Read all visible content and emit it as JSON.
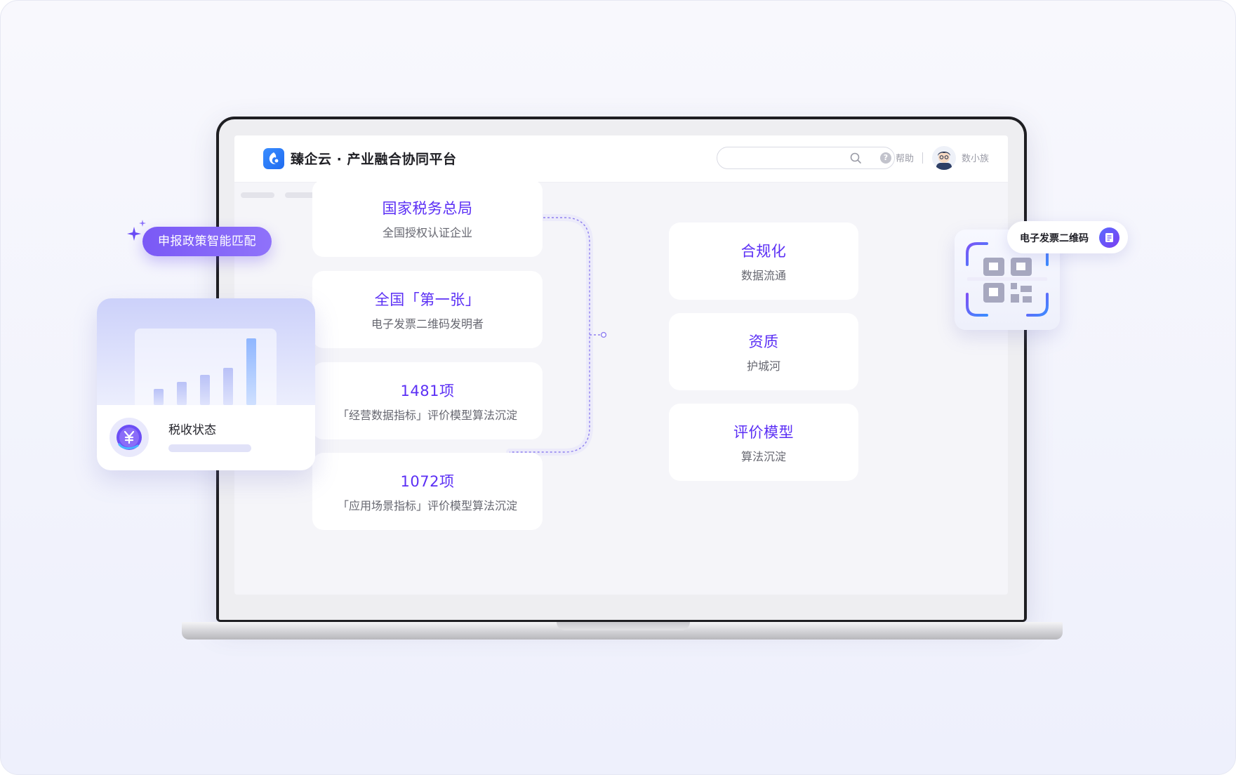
{
  "header": {
    "title": "臻企云 · 产业融合协同平台",
    "search_placeholder": "",
    "help_label": "帮助",
    "username": "数小族"
  },
  "left_cards": [
    {
      "title": "国家税务总局",
      "subtitle": "全国授权认证企业"
    },
    {
      "title": "全国「第一张」",
      "subtitle": "电子发票二维码发明者"
    },
    {
      "title": "1481项",
      "subtitle": "「经营数据指标」评价模型算法沉淀"
    },
    {
      "title": "1072项",
      "subtitle": "「应用场景指标」评价模型算法沉淀"
    }
  ],
  "right_cards": [
    {
      "title": "合规化",
      "subtitle": "数据流通"
    },
    {
      "title": "资质",
      "subtitle": "护城河"
    },
    {
      "title": "评价模型",
      "subtitle": "算法沉淀"
    }
  ],
  "overlays": {
    "policy_badge": "申报政策智能匹配",
    "tax_status": "税收状态",
    "qr_label": "电子发票二维码"
  },
  "colors": {
    "accent": "#5b2ff5",
    "badge": "#7a59f6",
    "logo": "#2f7cf6"
  }
}
